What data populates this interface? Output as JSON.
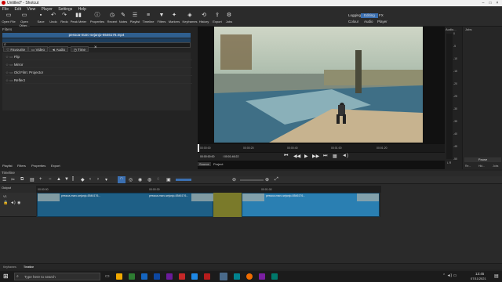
{
  "window": {
    "title": "Untitled* - Shotcut"
  },
  "menu": [
    "File",
    "Edit",
    "View",
    "Player",
    "Settings",
    "Help"
  ],
  "toolbar": {
    "buttons": [
      {
        "label": "Open File",
        "icon": "folder-open-icon"
      },
      {
        "label": "Open Other...",
        "icon": "folder-open-icon"
      },
      {
        "label": "Save",
        "icon": "save-icon"
      },
      {
        "label": "Undo",
        "icon": "undo-icon"
      },
      {
        "label": "Redo",
        "icon": "redo-icon"
      },
      {
        "label": "Peak Meter",
        "icon": "meter-icon"
      },
      {
        "label": "Properties",
        "icon": "info-icon"
      },
      {
        "label": "Recent",
        "icon": "clock-icon"
      },
      {
        "label": "Notes",
        "icon": "notes-icon"
      },
      {
        "label": "Playlist",
        "icon": "list-icon"
      },
      {
        "label": "Timeline",
        "icon": "timeline-icon"
      },
      {
        "label": "Filters",
        "icon": "filter-icon"
      },
      {
        "label": "Markers",
        "icon": "marker-icon"
      },
      {
        "label": "Keyframes",
        "icon": "keyframe-icon"
      },
      {
        "label": "History",
        "icon": "history-icon"
      },
      {
        "label": "Export",
        "icon": "export-icon"
      },
      {
        "label": "Jobs",
        "icon": "jobs-icon"
      }
    ],
    "layouts": [
      "Logging",
      "Editing",
      "FX"
    ],
    "active_layout": "Editing",
    "layout_sub": [
      "Colour",
      "Audio",
      "Player"
    ]
  },
  "filters": {
    "title": "Filters",
    "clip_name": "pessoa-marc-sejanjo-6546176.mp4",
    "search_placeholder": "",
    "tabs": [
      "Favourite",
      "Video",
      "Audio",
      "Time"
    ],
    "items": [
      "Flip",
      "Mirror",
      "Old Film: Projector",
      "Reflect"
    ]
  },
  "left_tabs": [
    "Playlist",
    "Filters",
    "Properties",
    "Export"
  ],
  "player": {
    "ruler": [
      "00:00:00",
      "00:00:20",
      "00:00:40",
      "00:01:00",
      "00:01:20"
    ],
    "timecode": "00:00:00:00",
    "duration": "/ 00:01:46:22",
    "tabs": [
      "Source",
      "Project"
    ]
  },
  "audio": {
    "title": "Audio...",
    "scale": [
      "0",
      "-5",
      "-10",
      "-15",
      "-20",
      "-25",
      "-30",
      "-35",
      "-40",
      "-45",
      "-50"
    ],
    "channels": "L  R"
  },
  "jobs": {
    "title": "Jobs",
    "pause_label": "Pause",
    "buttons": [
      "Re...",
      "Hid...",
      "Jobs"
    ]
  },
  "timeline": {
    "title": "Timeline",
    "track_label": "Output",
    "track_name": "V1",
    "ruler": [
      "00:00:00",
      "00:00:30",
      "00:01:00"
    ],
    "clip_labels": [
      "pessoa-marc-sejanjo-6546176...",
      "pessoa-marc-sejanjo-6546176...",
      "pessoa-marc-sejanjo-6546176..."
    ]
  },
  "bottom_tabs": [
    "Keyframes",
    "Timeline"
  ],
  "taskbar": {
    "search_placeholder": "Type here to search",
    "time": "13:45",
    "date": "07/11/2021"
  },
  "colors": {
    "accent": "#3b6fb0",
    "clip_blue": "#1e5f86",
    "clip_olive": "#7a7a2a",
    "background": "#232323"
  }
}
